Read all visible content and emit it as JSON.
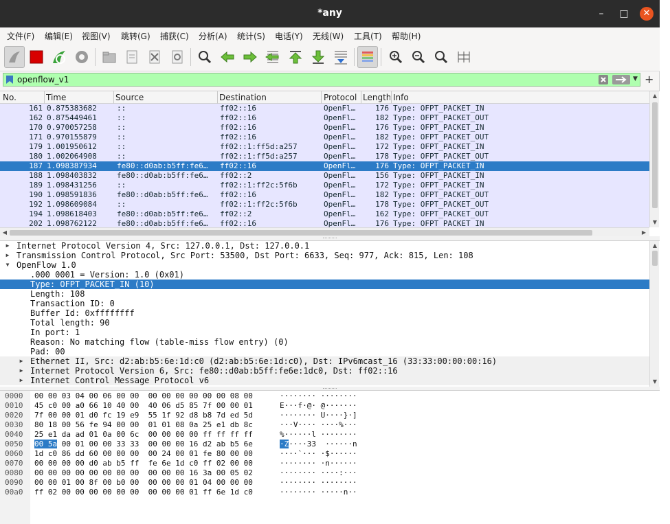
{
  "window": {
    "title": "*any",
    "controls": {
      "minimize": "–",
      "maximize": "□",
      "close": "✕"
    }
  },
  "menu": [
    "文件(F)",
    "编辑(E)",
    "视图(V)",
    "跳转(G)",
    "捕获(C)",
    "分析(A)",
    "统计(S)",
    "电话(Y)",
    "无线(W)",
    "工具(T)",
    "帮助(H)"
  ],
  "toolbar": {
    "icons": [
      "shark-fin-start-icon",
      "stop-capture-icon",
      "restart-capture-icon",
      "capture-options-icon",
      "open-file-icon",
      "save-file-icon",
      "close-file-icon",
      "reload-file-icon",
      "find-packet-icon",
      "go-back-icon",
      "go-forward-icon",
      "go-to-packet-icon",
      "go-first-icon",
      "go-last-icon",
      "autoscroll-icon",
      "colorize-icon",
      "zoom-in-icon",
      "zoom-out-icon",
      "zoom-normal-icon",
      "resize-columns-icon"
    ]
  },
  "filter": {
    "value": "openflow_v1",
    "bg_color": "#afffaf"
  },
  "packet_list": {
    "columns": [
      "No.",
      "Time",
      "Source",
      "Destination",
      "Protocol",
      "Length",
      "Info"
    ],
    "rows": [
      {
        "no": "161",
        "time": "0.875383682",
        "src": "::",
        "dst": "ff02::16",
        "proto": "OpenFl…",
        "len": "176",
        "info": "Type: OFPT_PACKET_IN"
      },
      {
        "no": "162",
        "time": "0.875449461",
        "src": "::",
        "dst": "ff02::16",
        "proto": "OpenFl…",
        "len": "182",
        "info": "Type: OFPT_PACKET_OUT"
      },
      {
        "no": "170",
        "time": "0.970057258",
        "src": "::",
        "dst": "ff02::16",
        "proto": "OpenFl…",
        "len": "176",
        "info": "Type: OFPT_PACKET_IN"
      },
      {
        "no": "171",
        "time": "0.970155879",
        "src": "::",
        "dst": "ff02::16",
        "proto": "OpenFl…",
        "len": "182",
        "info": "Type: OFPT_PACKET_OUT"
      },
      {
        "no": "179",
        "time": "1.001950612",
        "src": "::",
        "dst": "ff02::1:ff5d:a257",
        "proto": "OpenFl…",
        "len": "172",
        "info": "Type: OFPT_PACKET_IN"
      },
      {
        "no": "180",
        "time": "1.002064908",
        "src": "::",
        "dst": "ff02::1:ff5d:a257",
        "proto": "OpenFl…",
        "len": "178",
        "info": "Type: OFPT_PACKET_OUT"
      },
      {
        "no": "187",
        "time": "1.098387934",
        "src": "fe80::d0ab:b5ff:fe6…",
        "dst": "ff02::16",
        "proto": "OpenFl…",
        "len": "176",
        "info": "Type: OFPT_PACKET_IN"
      },
      {
        "no": "188",
        "time": "1.098403832",
        "src": "fe80::d0ab:b5ff:fe6…",
        "dst": "ff02::2",
        "proto": "OpenFl…",
        "len": "156",
        "info": "Type: OFPT_PACKET_IN"
      },
      {
        "no": "189",
        "time": "1.098431256",
        "src": "::",
        "dst": "ff02::1:ff2c:5f6b",
        "proto": "OpenFl…",
        "len": "172",
        "info": "Type: OFPT_PACKET_IN"
      },
      {
        "no": "190",
        "time": "1.098591836",
        "src": "fe80::d0ab:b5ff:fe6…",
        "dst": "ff02::16",
        "proto": "OpenFl…",
        "len": "182",
        "info": "Type: OFPT_PACKET_OUT"
      },
      {
        "no": "192",
        "time": "1.098609084",
        "src": "::",
        "dst": "ff02::1:ff2c:5f6b",
        "proto": "OpenFl…",
        "len": "178",
        "info": "Type: OFPT_PACKET_OUT"
      },
      {
        "no": "194",
        "time": "1.098618403",
        "src": "fe80::d0ab:b5ff:fe6…",
        "dst": "ff02::2",
        "proto": "OpenFl…",
        "len": "162",
        "info": "Type: OFPT_PACKET_OUT"
      },
      {
        "no": "202",
        "time": "1.098762122",
        "src": "fe80::d0ab:b5ff:fe6…",
        "dst": "ff02::16",
        "proto": "OpenFl…",
        "len": "176",
        "info": "Type: OFPT_PACKET_IN"
      }
    ],
    "selected_index": 6,
    "row_color": "#e7e6ff",
    "selected_color": "#2c7bc6"
  },
  "details": {
    "lines": [
      {
        "text": "Internet Protocol Version 4, Src: 127.0.0.1, Dst: 127.0.0.1",
        "toggle": "▶"
      },
      {
        "text": "Transmission Control Protocol, Src Port: 53500, Dst Port: 6633, Seq: 977, Ack: 815, Len: 108",
        "toggle": "▶"
      },
      {
        "text": "OpenFlow 1.0",
        "toggle": "▼"
      },
      {
        "text": ".000 0001 = Version: 1.0 (0x01)",
        "toggle": ""
      },
      {
        "text": "Type: OFPT_PACKET_IN (10)",
        "toggle": ""
      },
      {
        "text": "Length: 108",
        "toggle": ""
      },
      {
        "text": "Transaction ID: 0",
        "toggle": ""
      },
      {
        "text": "Buffer Id: 0xffffffff",
        "toggle": ""
      },
      {
        "text": "Total length: 90",
        "toggle": ""
      },
      {
        "text": "In port: 1",
        "toggle": ""
      },
      {
        "text": "Reason: No matching flow (table-miss flow entry) (0)",
        "toggle": ""
      },
      {
        "text": "Pad: 00",
        "toggle": ""
      },
      {
        "text": "Ethernet II, Src: d2:ab:b5:6e:1d:c0 (d2:ab:b5:6e:1d:c0), Dst: IPv6mcast_16 (33:33:00:00:00:16)",
        "toggle": "▶"
      },
      {
        "text": "Internet Protocol Version 6, Src: fe80::d0ab:b5ff:fe6e:1dc0, Dst: ff02::16",
        "toggle": "▶"
      },
      {
        "text": "Internet Control Message Protocol v6",
        "toggle": "▶"
      }
    ],
    "selected_index": 4
  },
  "bytes": {
    "rows": [
      {
        "off": "0000",
        "hex": "00 00 03 04 00 06 00 00  00 00 00 00 00 00 08 00",
        "ascii": "········ ········"
      },
      {
        "off": "0010",
        "hex": "45 c0 00 a0 66 10 40 00  40 06 d5 85 7f 00 00 01",
        "ascii": "E···f·@· @·······"
      },
      {
        "off": "0020",
        "hex": "7f 00 00 01 d0 fc 19 e9  55 1f 92 d8 b8 7d ed 5d",
        "ascii": "········ U····}·]"
      },
      {
        "off": "0030",
        "hex": "80 18 00 56 fe 94 00 00  01 01 08 0a 25 e1 db 8c",
        "ascii": "···V···· ····%···"
      },
      {
        "off": "0040",
        "hex": "25 e1 da ad 01 0a 00 6c  00 00 00 00 ff ff ff ff",
        "ascii": "%······l ········"
      },
      {
        "off": "0050",
        "hex_hl": "00 5a",
        "hex": " 00 01 00 00 33 33  00 00 00 16 d2 ab b5 6e",
        "ascii_hl": "·Z",
        "ascii": "····33  ······n"
      },
      {
        "off": "0060",
        "hex": "1d c0 86 dd 60 00 00 00  00 24 00 01 fe 80 00 00",
        "ascii": "····`··· ·$······"
      },
      {
        "off": "0070",
        "hex": "00 00 00 00 d0 ab b5 ff  fe 6e 1d c0 ff 02 00 00",
        "ascii": "········ ·n······"
      },
      {
        "off": "0080",
        "hex": "00 00 00 00 00 00 00 00  00 00 00 16 3a 00 05 02",
        "ascii": "········ ····:···"
      },
      {
        "off": "0090",
        "hex": "00 00 01 00 8f 00 b0 00  00 00 00 01 04 00 00 00",
        "ascii": "········ ········"
      },
      {
        "off": "00a0",
        "hex": "ff 02 00 00 00 00 00 00  00 00 00 01 ff 6e 1d c0",
        "ascii": "········ ·····n··"
      }
    ]
  }
}
